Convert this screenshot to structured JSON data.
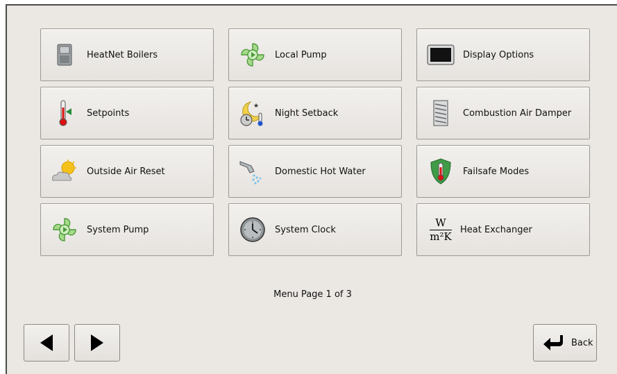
{
  "menu": {
    "items": [
      {
        "label": "HeatNet Boilers",
        "icon": "boiler-icon"
      },
      {
        "label": "Local Pump",
        "icon": "pump-icon"
      },
      {
        "label": "Display Options",
        "icon": "display-icon"
      },
      {
        "label": "Setpoints",
        "icon": "thermometer-icon"
      },
      {
        "label": "Night Setback",
        "icon": "night-setback-icon"
      },
      {
        "label": "Combustion Air Damper",
        "icon": "damper-icon"
      },
      {
        "label": "Outside Air Reset",
        "icon": "sun-cloud-icon"
      },
      {
        "label": "Domestic Hot Water",
        "icon": "faucet-icon"
      },
      {
        "label": "Failsafe Modes",
        "icon": "shield-icon"
      },
      {
        "label": "System Pump",
        "icon": "pump-icon"
      },
      {
        "label": "System Clock",
        "icon": "clock-icon"
      },
      {
        "label": "Heat Exchanger",
        "icon": "heat-exchanger-fraction-icon"
      }
    ]
  },
  "units": {
    "numerator": "W",
    "denominator": "m²K"
  },
  "page_label": "Menu Page 1 of 3",
  "nav": {
    "back_label": "Back"
  },
  "colors": {
    "panel": "#ebe8e4",
    "button": "#eeebe8",
    "border": "#9c9994"
  }
}
